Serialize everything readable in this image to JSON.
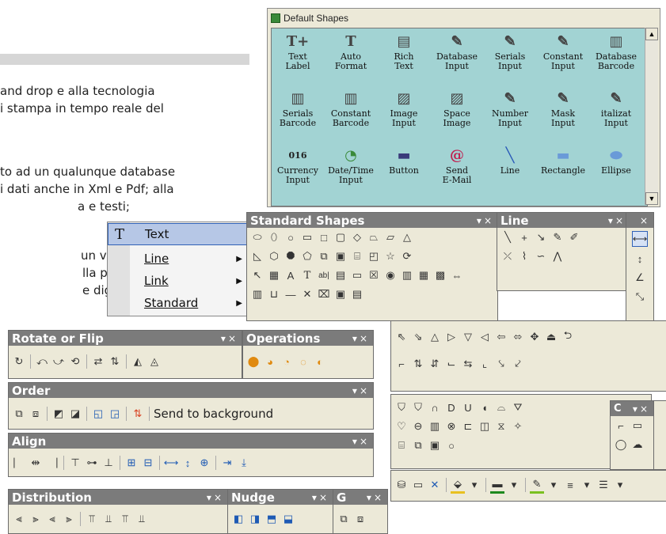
{
  "background_text": [
    " and drop e alla tecnologia",
    "i stampa in tempo reale del",
    "to ad un qualunque database",
    "i dati anche in Xml e Pdf; alla",
    "a e testi;",
    " un veloce",
    "lla più pic-",
    "e digitale;"
  ],
  "default_shapes": {
    "title": "Default Shapes",
    "items": [
      {
        "label": "Text\nLabel",
        "icon": "text-label-icon"
      },
      {
        "label": "Auto\nFormat",
        "icon": "auto-format-icon"
      },
      {
        "label": "Rich\nText",
        "icon": "rich-text-icon"
      },
      {
        "label": "Database\nInput",
        "icon": "database-input-icon"
      },
      {
        "label": "Serials\nInput",
        "icon": "serials-input-icon"
      },
      {
        "label": "Constant\nInput",
        "icon": "constant-input-icon"
      },
      {
        "label": "Database\nBarcode",
        "icon": "database-barcode-icon"
      },
      {
        "label": "Serials\nBarcode",
        "icon": "serials-barcode-icon"
      },
      {
        "label": "Constant\nBarcode",
        "icon": "constant-barcode-icon"
      },
      {
        "label": "Image\nInput",
        "icon": "image-input-icon"
      },
      {
        "label": "Space\nImage",
        "icon": "space-image-icon"
      },
      {
        "label": "Number\nInput",
        "icon": "number-input-icon"
      },
      {
        "label": "Mask\nInput",
        "icon": "mask-input-icon"
      },
      {
        "label": "italizat\nInput",
        "icon": "capitalization-input-icon"
      },
      {
        "label": "Currency\nInput",
        "icon": "currency-input-icon"
      },
      {
        "label": "Date/Time\nInput",
        "icon": "datetime-input-icon"
      },
      {
        "label": "Button",
        "icon": "button-icon"
      },
      {
        "label": "Send\nE-Mail",
        "icon": "send-email-icon"
      },
      {
        "label": "Line",
        "icon": "line-icon"
      },
      {
        "label": "Rectangle",
        "icon": "rectangle-icon"
      },
      {
        "label": "Ellipse",
        "icon": "ellipse-icon"
      }
    ]
  },
  "menu": {
    "items": [
      {
        "label": "Text",
        "icon": "T"
      },
      {
        "label": "Line"
      },
      {
        "label": "Link"
      },
      {
        "label": "Standard"
      }
    ]
  },
  "toolbars": {
    "standard_shapes": "Standard Shapes",
    "line": "Line",
    "rotate_flip": "Rotate or Flip",
    "operations": "Operations",
    "order": "Order",
    "send_to_background": "Send to background",
    "align": "Align",
    "distribution": "Distribution",
    "nudge": "Nudge",
    "g": "G",
    "c": "C",
    "close": "×",
    "dropdown": "▾"
  },
  "colors": {
    "grid_bg": "#a2d3d3",
    "title_bar": "#7b7b7b",
    "menu_selected": "#b6c7e6"
  }
}
